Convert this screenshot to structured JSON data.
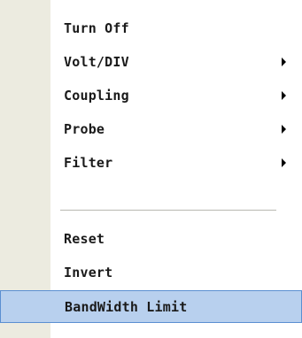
{
  "menu": {
    "items": [
      {
        "label": "Turn Off",
        "has_submenu": false
      },
      {
        "label": "Volt/DIV",
        "has_submenu": true
      },
      {
        "label": "Coupling",
        "has_submenu": true
      },
      {
        "label": "Probe",
        "has_submenu": true
      },
      {
        "label": "Filter",
        "has_submenu": true
      },
      {
        "label": "Reset",
        "has_submenu": false
      },
      {
        "label": "Invert",
        "has_submenu": false
      },
      {
        "label": "BandWidth Limit",
        "has_submenu": false,
        "selected": true
      }
    ]
  },
  "colors": {
    "gutter": "#ecebe0",
    "selection_fill": "#b8d0ee",
    "selection_border": "#5a8fd1",
    "text": "#1a1a1a"
  }
}
